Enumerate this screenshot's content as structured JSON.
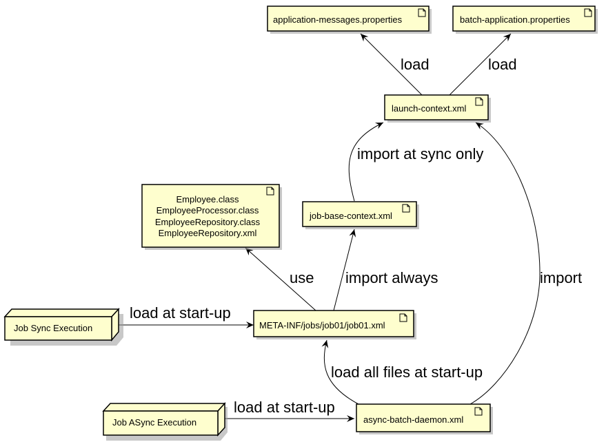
{
  "colors": {
    "node_fill": "#FEFECE",
    "node_stroke": "#000000",
    "shadow": "#9a9a9a",
    "edge": "#000000"
  },
  "nodes": {
    "app_messages": {
      "label": "application-messages.properties",
      "kind": "artifact",
      "icon": "document-icon"
    },
    "batch_app": {
      "label": "batch-application.properties",
      "kind": "artifact",
      "icon": "document-icon"
    },
    "launch_context": {
      "label": "launch-context.xml",
      "kind": "artifact",
      "icon": "document-icon"
    },
    "employee_files": {
      "lines": [
        "Employee.class",
        "EmployeeProcessor.class",
        "EmployeeRepository.class",
        "EmployeeRepository.xml"
      ],
      "kind": "artifact",
      "icon": "document-icon"
    },
    "job_base_context": {
      "label": "job-base-context.xml",
      "kind": "artifact",
      "icon": "document-icon"
    },
    "job01": {
      "label": "META-INF/jobs/job01/job01.xml",
      "kind": "artifact",
      "icon": "document-icon"
    },
    "async_daemon": {
      "label": "async-batch-daemon.xml",
      "kind": "artifact",
      "icon": "document-icon"
    },
    "job_sync": {
      "label": "Job Sync Execution",
      "kind": "node"
    },
    "job_async": {
      "label": "Job ASync Execution",
      "kind": "node"
    }
  },
  "edges": {
    "launch_to_app_messages": {
      "from": "launch-context.xml",
      "to": "application-messages.properties",
      "label": "load"
    },
    "launch_to_batch_app": {
      "from": "launch-context.xml",
      "to": "batch-application.properties",
      "label": "load"
    },
    "base_to_launch": {
      "from": "job-base-context.xml",
      "to": "launch-context.xml",
      "label": "import at sync only"
    },
    "job01_to_employee": {
      "from": "META-INF/jobs/job01/job01.xml",
      "to": "Employee files",
      "label": "use"
    },
    "job01_to_base": {
      "from": "META-INF/jobs/job01/job01.xml",
      "to": "job-base-context.xml",
      "label": "import always"
    },
    "daemon_to_launch": {
      "from": "async-batch-daemon.xml",
      "to": "launch-context.xml",
      "label": "import"
    },
    "sync_to_job01": {
      "from": "Job Sync Execution",
      "to": "META-INF/jobs/job01/job01.xml",
      "label": "load at start-up"
    },
    "daemon_to_job01": {
      "from": "async-batch-daemon.xml",
      "to": "META-INF/jobs/job01/job01.xml",
      "label": "load all files at start-up"
    },
    "async_to_daemon": {
      "from": "Job ASync Execution",
      "to": "async-batch-daemon.xml",
      "label": "load at start-up"
    }
  }
}
